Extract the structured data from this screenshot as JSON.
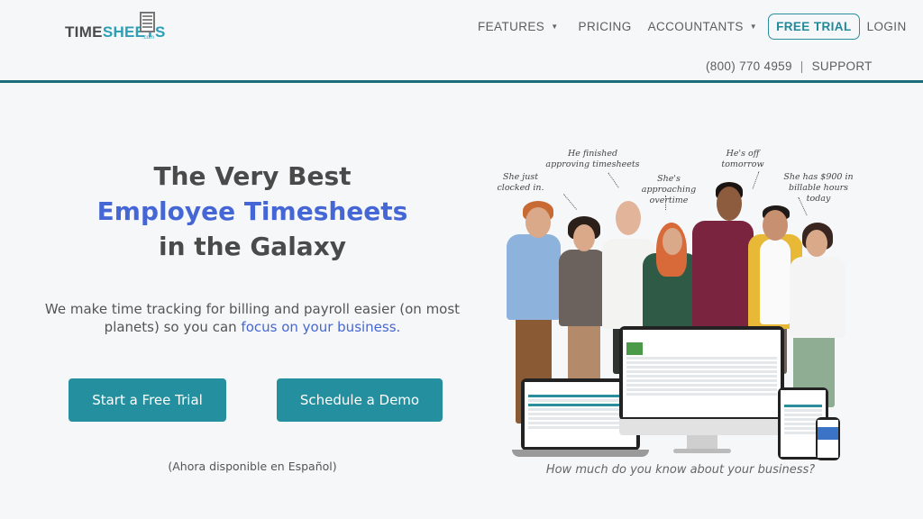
{
  "brand": {
    "logo_part1": "TIME",
    "logo_part2": "SHEETS",
    "logo_suffix": ".com"
  },
  "nav": {
    "items": [
      {
        "label": "FEATURES",
        "has_dropdown": true
      },
      {
        "label": "PRICING",
        "has_dropdown": false
      },
      {
        "label": "ACCOUNTANTS",
        "has_dropdown": true
      }
    ],
    "free_trial_label": "FREE TRIAL",
    "login_label": "LOGIN",
    "phone": "(800) 770 4959",
    "separator": "|",
    "support_label": "SUPPORT"
  },
  "hero": {
    "title_line1": "The Very Best",
    "title_line2": "Employee Timesheets",
    "title_line3": "in the Galaxy",
    "subtitle_main": "We make time tracking for billing and payroll easier (on most planets) so you can ",
    "subtitle_accent": "focus on your business.",
    "cta_trial": "Start a Free Trial",
    "cta_demo": "Schedule a Demo",
    "language_note": "(Ahora disponible en Español)"
  },
  "illustration": {
    "annotations": [
      "She just clocked in.",
      "He finished approving timesheets",
      "She's approaching overtime",
      "He's off tomorrow",
      "She has $900 in billable hours today"
    ],
    "caption": "How much do you know about your business?"
  },
  "colors": {
    "accent_blue": "#4567d6",
    "brand_teal": "#248f9f",
    "header_rule": "#1c6d7c"
  }
}
